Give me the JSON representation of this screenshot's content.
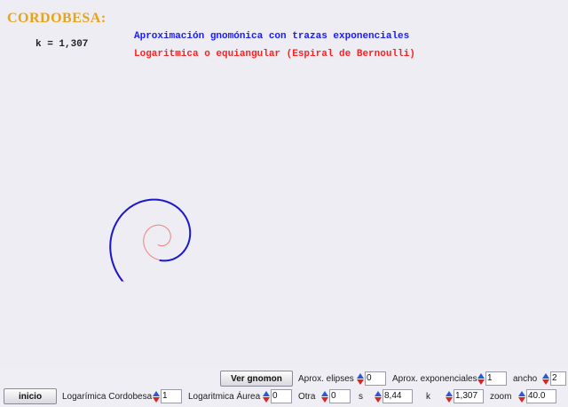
{
  "header": {
    "title": "CORDOBESA:",
    "k_label": "k = 1,307",
    "subtitle_blue": "Aproximación gnomónica con trazas exponenciales",
    "subtitle_red": "Logaritmica o equiangular (Espiral de Bernoulli)"
  },
  "colors": {
    "title": "#e8a317",
    "approx_curve": "#1a1acc",
    "log_spiral": "#f08080"
  },
  "toolbar_top": {
    "ver_gnomon_label": "Ver gnomon",
    "aprox_elipses_label": "Aprox. elipses",
    "aprox_elipses_value": "0",
    "aprox_exponenciales_label": "Aprox. exponenciales",
    "aprox_exponenciales_value": "1",
    "ancho_label": "ancho",
    "ancho_value": "2"
  },
  "toolbar_bottom": {
    "inicio_label": "inicio",
    "log_cordobesa_label": "Logarímica Cordobesa",
    "log_cordobesa_value": "1",
    "log_aurea_label": "Logaritmica Áurea",
    "log_aurea_value": "0",
    "otra_label": "Otra",
    "otra_value": "0",
    "s_label": "s",
    "s_value": "8,44",
    "k_label": "k",
    "k_value": "1,307",
    "zoom_label": "zoom",
    "zoom_value": "40.0"
  }
}
